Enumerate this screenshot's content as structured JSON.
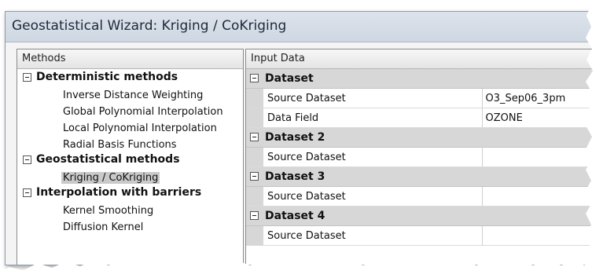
{
  "window": {
    "title": "Geostatistical Wizard: Kriging / CoKriging"
  },
  "methods": {
    "header": "Methods",
    "groups": [
      {
        "label": "Deterministic methods",
        "items": [
          "Inverse Distance Weighting",
          "Global Polynomial Interpolation",
          "Local Polynomial Interpolation",
          "Radial Basis Functions"
        ]
      },
      {
        "label": "Geostatistical methods",
        "items": [
          "Kriging / CoKriging"
        ]
      },
      {
        "label": "Interpolation with barriers",
        "items": [
          "Kernel Smoothing",
          "Diffusion Kernel"
        ]
      }
    ],
    "selected": "Kriging / CoKriging"
  },
  "input_data": {
    "header": "Input Data",
    "categories": [
      {
        "label": "Dataset",
        "rows": [
          {
            "name": "Source Dataset",
            "value": "O3_Sep06_3pm"
          },
          {
            "name": "Data Field",
            "value": "OZONE"
          }
        ]
      },
      {
        "label": "Dataset 2",
        "rows": [
          {
            "name": "Source Dataset",
            "value": ""
          }
        ]
      },
      {
        "label": "Dataset 3",
        "rows": [
          {
            "name": "Source Dataset",
            "value": ""
          }
        ]
      },
      {
        "label": "Dataset 4",
        "rows": [
          {
            "name": "Source Dataset",
            "value": ""
          }
        ]
      }
    ]
  }
}
